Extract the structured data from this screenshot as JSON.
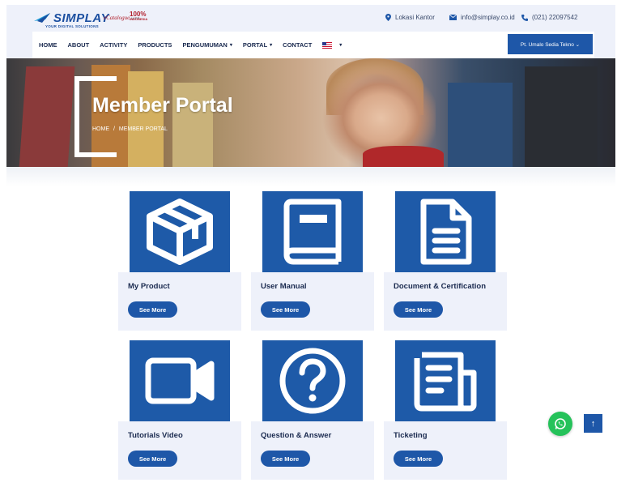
{
  "brand": {
    "name": "SIMPLAY",
    "tagline": "YOUR DIGITAL SOLUTIONS",
    "badge_ecatalogue": "eCatalogue",
    "badge_ecatalogue_sub": "LKPP",
    "badge_100": "100%",
    "badge_100_sub": "INDONESIA"
  },
  "contacts": {
    "office": "Lokasi Kantor",
    "email": "info@simplay.co.id",
    "phone": "(021) 22097542"
  },
  "nav": {
    "items": [
      {
        "label": "HOME",
        "dropdown": false
      },
      {
        "label": "ABOUT",
        "dropdown": false
      },
      {
        "label": "ACTIVITY",
        "dropdown": false
      },
      {
        "label": "PRODUCTS",
        "dropdown": false
      },
      {
        "label": "PENGUMUMAN",
        "dropdown": true
      },
      {
        "label": "PORTAL",
        "dropdown": true
      },
      {
        "label": "CONTACT",
        "dropdown": false
      }
    ],
    "chevron": "⌄",
    "company_button": "Pt. Umalo Sedia Tekno ⌄"
  },
  "hero": {
    "title": "Member Portal",
    "breadcrumb_home": "HOME",
    "breadcrumb_sep": "/",
    "breadcrumb_current": "MEMBER PORTAL"
  },
  "cards": [
    {
      "title": "My Product",
      "button": "See More",
      "icon": "box-icon"
    },
    {
      "title": "User Manual",
      "button": "See More",
      "icon": "book-icon"
    },
    {
      "title": "Document & Certification",
      "button": "See More",
      "icon": "document-icon"
    },
    {
      "title": "Tutorials Video",
      "button": "See More",
      "icon": "video-camera-icon"
    },
    {
      "title": "Question & Answer",
      "button": "See More",
      "icon": "question-icon"
    },
    {
      "title": "Ticketing",
      "button": "See More",
      "icon": "newspaper-icon"
    }
  ],
  "floating": {
    "scroll_top_glyph": "↑"
  },
  "colors": {
    "primary": "#1e57a8",
    "card_bg": "#eef1fa",
    "whatsapp": "#25c25a",
    "text_dark": "#1a2a4f"
  }
}
